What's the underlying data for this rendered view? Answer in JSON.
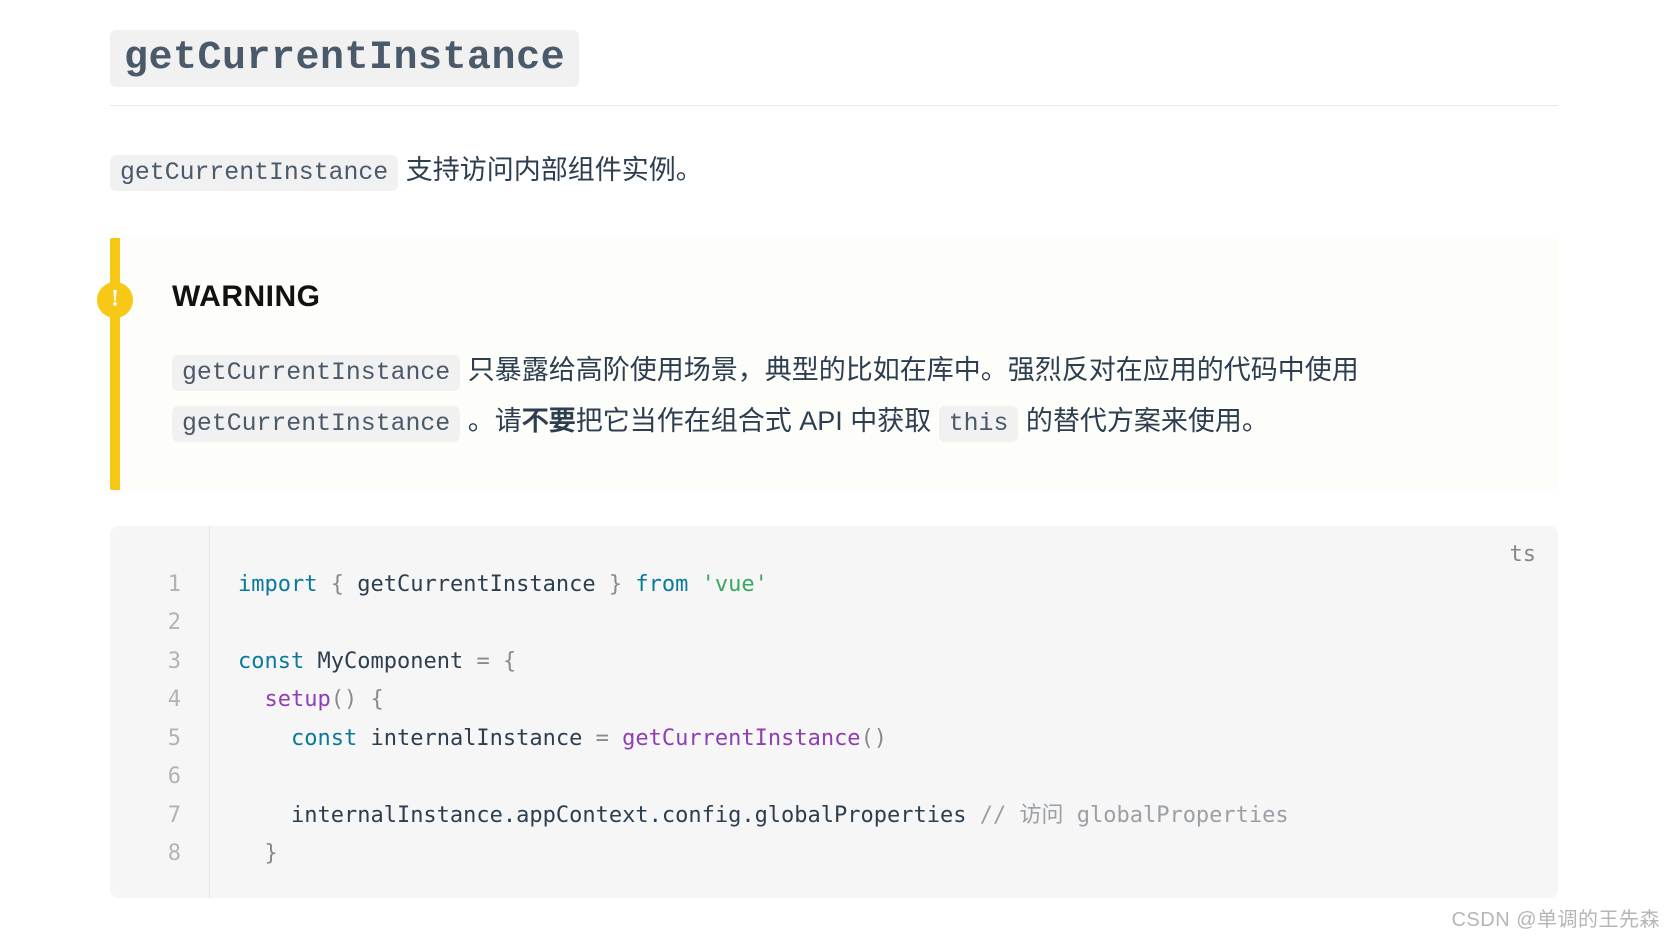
{
  "heading": {
    "code": "getCurrentInstance"
  },
  "intro": {
    "code": "getCurrentInstance",
    "text": " 支持访问内部组件实例。"
  },
  "warning": {
    "badge": "!",
    "title": "WARNING",
    "code1": "getCurrentInstance",
    "seg1": " 只暴露给高阶使用场景，典型的比如在库中。强烈反对在应用的代码中使用 ",
    "code2": "getCurrentInstance",
    "seg2": " 。请",
    "bold": "不要",
    "seg3": "把它当作在组合式 API 中获取 ",
    "code3": "this",
    "seg4": " 的替代方案来使用。"
  },
  "code": {
    "lang": "ts",
    "line_numbers": [
      "1",
      "2",
      "3",
      "4",
      "5",
      "6",
      "7",
      "8"
    ],
    "l1": {
      "import": "import",
      "lb": "{",
      "name": "getCurrentInstance",
      "rb": "}",
      "from": "from",
      "str": "'vue'"
    },
    "l3": {
      "const": "const",
      "name": "MyComponent",
      "eq": "=",
      "lb": "{"
    },
    "l4": {
      "setup": "setup",
      "paren": "()",
      "lb": "{"
    },
    "l5": {
      "const": "const",
      "name": "internalInstance",
      "eq": "=",
      "fn": "getCurrentInstance",
      "paren": "()"
    },
    "l7": {
      "expr": "internalInstance.appContext.config.globalProperties",
      "comment": "// 访问 globalProperties"
    },
    "l8": {
      "rb": "}"
    }
  },
  "watermark": "CSDN @单调的王先森"
}
